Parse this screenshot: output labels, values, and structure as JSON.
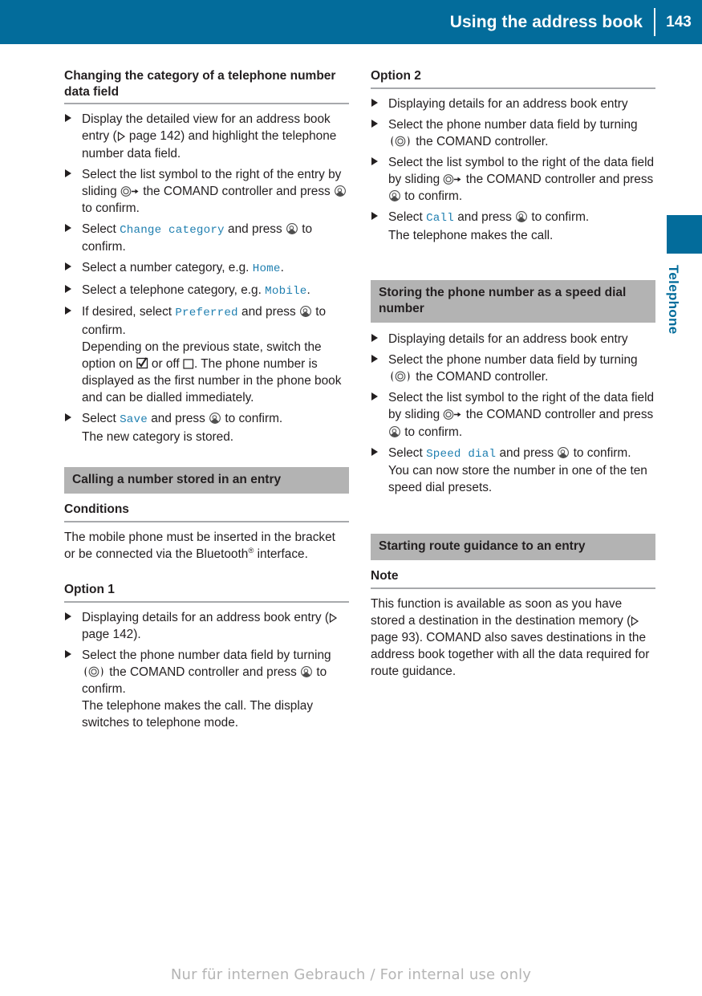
{
  "header": {
    "title": "Using the address book",
    "page_number": "143"
  },
  "side_tab": {
    "label": "Telephone",
    "color": "#036c9b"
  },
  "footer": {
    "watermark": "Nur für internen Gebrauch / For internal use only"
  },
  "colors": {
    "header_blue": "#036c9b",
    "bar_gray": "#b3b3b3",
    "rule_gray": "#a7a9ac",
    "ui_blue": "#1f7fb0",
    "text": "#231f20"
  },
  "left_column": {
    "section1": {
      "heading": "Changing the category of a telephone number data field",
      "steps": [
        {
          "pre": "Display the detailed view for an address book entry (",
          "icon": "ref-arrow-icon",
          "mid": " page 142) and highlight the telephone number data field.",
          "post": ""
        },
        {
          "pre": "Select the list symbol to the right of the entry by sliding ",
          "icon": "slide-controller-icon",
          "mid": " the COMAND controller and press ",
          "icon2": "press-controller-icon",
          "post": " to confirm."
        },
        {
          "pre": "Select ",
          "ui": "Change category",
          "post": " and press ",
          "icon2": "press-controller-icon",
          "tail": " to confirm."
        },
        {
          "pre": "Select a number category, e.g. ",
          "ui": "Home",
          "post": "."
        },
        {
          "pre": "Select a telephone category, e.g. ",
          "ui": "Mobile",
          "post": "."
        },
        {
          "pre": "If desired, select ",
          "ui": "Preferred",
          "post": " and press ",
          "icon2": "press-controller-icon",
          "tail": " to confirm.",
          "continuation_a": "Depending on the previous state, switch the option on ",
          "icon_check": "checkbox-checked-icon",
          "continuation_b": " or off ",
          "icon_uncheck": "checkbox-unchecked-icon",
          "continuation_c": ". The phone number is displayed as the first number in the phone book and can be dialled immediately."
        },
        {
          "pre": "Select ",
          "ui": "Save",
          "post": " and press ",
          "icon2": "press-controller-icon",
          "tail": " to confirm.",
          "continuation_a": "The new category is stored."
        }
      ]
    },
    "section2": {
      "bar_heading": "Calling a number stored in an entry",
      "sub1": "Conditions",
      "body1_a": "The mobile phone must be inserted in the bracket or be connected via the Bluetooth",
      "body1_reg": "®",
      "body1_b": " interface.",
      "sub2": "Option 1",
      "steps": [
        {
          "pre": "Displaying details for an address book entry (",
          "icon": "ref-arrow-icon",
          "mid": " page 142)."
        },
        {
          "pre": "Select the phone number data field by turning ",
          "icon_turn": "turn-controller-icon",
          "mid": " the COMAND controller and press ",
          "icon2": "press-controller-icon",
          "post": " to confirm.",
          "continuation_a": "The telephone makes the call. The display switches to telephone mode."
        }
      ]
    }
  },
  "right_column": {
    "section1": {
      "sub": "Option 2",
      "steps": [
        {
          "pre": "Displaying details for an address book entry"
        },
        {
          "pre": "Select the phone number data field by turning ",
          "icon_turn": "turn-controller-icon",
          "mid": " the COMAND controller."
        },
        {
          "pre": "Select the list symbol to the right of the data field by sliding ",
          "icon": "slide-controller-icon",
          "mid": " the COMAND controller and press ",
          "icon2": "press-controller-icon",
          "post": " to confirm."
        },
        {
          "pre": "Select ",
          "ui": "Call",
          "post": " and press ",
          "icon2": "press-controller-icon",
          "tail": " to confirm.",
          "continuation_a": "The telephone makes the call."
        }
      ]
    },
    "section2": {
      "bar_heading": "Storing the phone number as a speed dial number",
      "steps": [
        {
          "pre": "Displaying details for an address book entry"
        },
        {
          "pre": "Select the phone number data field by turning ",
          "icon_turn": "turn-controller-icon",
          "mid": " the COMAND controller."
        },
        {
          "pre": "Select the list symbol to the right of the data field by sliding ",
          "icon": "slide-controller-icon",
          "mid": " the COMAND controller and press ",
          "icon2": "press-controller-icon",
          "post": " to confirm."
        },
        {
          "pre": "Select ",
          "ui": "Speed dial",
          "post": " and press ",
          "icon2": "press-controller-icon",
          "tail": " to confirm.",
          "continuation_a": "You can now store the number in one of the ten speed dial presets."
        }
      ]
    },
    "section3": {
      "bar_heading": "Starting route guidance to an entry",
      "sub": "Note",
      "body_a": "This function is available as soon as you have stored a destination in the destination memory (",
      "body_icon": "ref-arrow-icon",
      "body_b": " page 93). COMAND also saves destinations in the address book together with all the data required for route guidance."
    }
  }
}
